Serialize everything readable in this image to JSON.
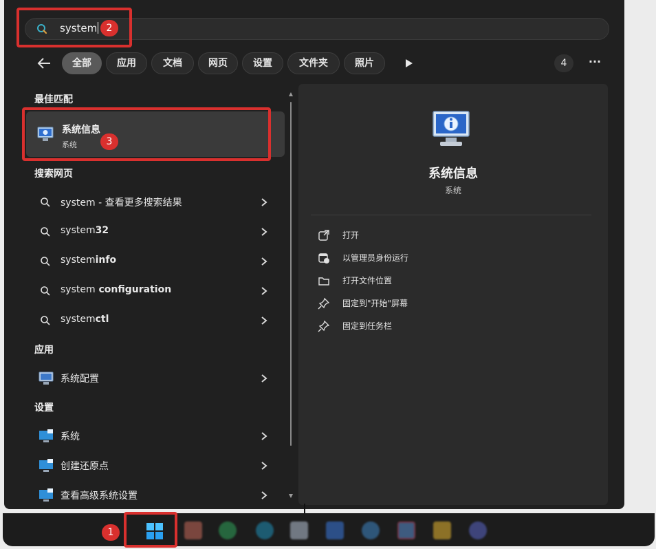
{
  "search": {
    "query": "system"
  },
  "filters": {
    "chips": [
      "全部",
      "应用",
      "文档",
      "网页",
      "设置",
      "文件夹",
      "照片"
    ],
    "count": "4",
    "more": "···"
  },
  "sections": {
    "best_match": "最佳匹配",
    "web": "搜索网页",
    "apps": "应用",
    "settings": "设置"
  },
  "best_match": {
    "title": "系统信息",
    "subtitle": "系统"
  },
  "web_results": [
    {
      "prefix": "system",
      "suffix": " - 查看更多搜索结果"
    },
    {
      "prefix": "system",
      "suffix": "32"
    },
    {
      "prefix": "system",
      "suffix": "info"
    },
    {
      "prefix": "system",
      "suffix": " configuration"
    },
    {
      "prefix": "system",
      "suffix": "ctl"
    }
  ],
  "apps": [
    {
      "label": "系统配置"
    }
  ],
  "settings": [
    {
      "label": "系统"
    },
    {
      "label": "创建还原点"
    },
    {
      "label": "查看高级系统设置"
    }
  ],
  "detail": {
    "title": "系统信息",
    "subtitle": "系统",
    "actions": [
      "打开",
      "以管理员身份运行",
      "打开文件位置",
      "固定到\"开始\"屏幕",
      "固定到任务栏"
    ]
  },
  "annotations": [
    "1",
    "2",
    "3"
  ],
  "colors": {
    "annotation_red": "#d9302e",
    "panel_bg": "#202020",
    "selected_bg": "#3a3a3a",
    "search_accent": "#3ab0c8"
  },
  "icons": {
    "search_bar": "search-icon",
    "back": "back-arrow-icon",
    "play": "play-icon",
    "web_result": "search-icon",
    "chevron": "chevron-right-icon",
    "app": "system-info-icon",
    "actions": [
      "open-external-icon",
      "admin-shield-icon",
      "folder-icon",
      "pin-icon",
      "pin-icon"
    ],
    "taskbar": [
      "windows-start-icon",
      "app-icon",
      "app-icon",
      "edge-icon",
      "app-icon",
      "app-icon",
      "app-icon",
      "app-icon",
      "folder-icon",
      "app-icon"
    ]
  }
}
